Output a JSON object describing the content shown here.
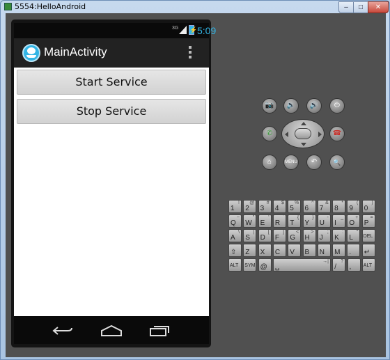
{
  "window": {
    "title": "5554:HelloAndroid",
    "min_label": "–",
    "max_label": "□",
    "close_label": "✕"
  },
  "status_bar": {
    "network": "3G",
    "time": "5:09",
    "battery_glyph": "⚡"
  },
  "action_bar": {
    "title": "MainActivity"
  },
  "buttons": {
    "start": "Start Service",
    "stop": "Stop Service"
  },
  "navbar": {
    "icons": [
      "back-icon",
      "home-icon",
      "recent-apps-icon"
    ]
  },
  "controls": {
    "camera": "📷",
    "vol_down": "🔉",
    "vol_up": "🔊",
    "power": "⏻",
    "call": "✆",
    "end_call": "☎",
    "home": "⌂",
    "menu": "MENU",
    "back": "↶",
    "search": "🔍"
  },
  "keyboard": {
    "rows": [
      [
        {
          "k": "1",
          "a": "!"
        },
        {
          "k": "2",
          "a": "@"
        },
        {
          "k": "3",
          "a": "#"
        },
        {
          "k": "4",
          "a": "$"
        },
        {
          "k": "5",
          "a": "%"
        },
        {
          "k": "6",
          "a": "^"
        },
        {
          "k": "7",
          "a": "&"
        },
        {
          "k": "8",
          "a": "*"
        },
        {
          "k": "9",
          "a": "("
        },
        {
          "k": "0",
          "a": ")"
        }
      ],
      [
        {
          "k": "Q",
          "a": "~"
        },
        {
          "k": "W",
          "a": "\""
        },
        {
          "k": "E",
          "a": "'"
        },
        {
          "k": "R",
          "a": "`"
        },
        {
          "k": "T",
          "a": "{"
        },
        {
          "k": "Y",
          "a": "}"
        },
        {
          "k": "U",
          "a": "-"
        },
        {
          "k": "I",
          "a": "_"
        },
        {
          "k": "O",
          "a": "+"
        },
        {
          "k": "P",
          "a": "="
        }
      ],
      [
        {
          "k": "A",
          "a": "\\"
        },
        {
          "k": "S",
          "a": "|"
        },
        {
          "k": "D",
          "a": "["
        },
        {
          "k": "F",
          "a": "]"
        },
        {
          "k": "G",
          "a": "<"
        },
        {
          "k": "H",
          "a": ">"
        },
        {
          "k": "J",
          "a": ";"
        },
        {
          "k": "K",
          "a": ":"
        },
        {
          "k": "L",
          "a": "\""
        },
        {
          "k": "DEL",
          "a": ""
        }
      ],
      [
        {
          "k": "⇧",
          "a": ""
        },
        {
          "k": "Z",
          "a": ""
        },
        {
          "k": "X",
          "a": ""
        },
        {
          "k": "C",
          "a": ""
        },
        {
          "k": "V",
          "a": ""
        },
        {
          "k": "B",
          "a": ""
        },
        {
          "k": "N",
          "a": ""
        },
        {
          "k": "M",
          "a": ""
        },
        {
          "k": ".",
          "a": ""
        },
        {
          "k": "↵",
          "a": ""
        }
      ],
      [
        {
          "k": "ALT",
          "a": ""
        },
        {
          "k": "SYM",
          "a": ""
        },
        {
          "k": "@",
          "a": ""
        },
        {
          "k": "␣",
          "a": "→|"
        },
        {
          "k": "/",
          "a": "?"
        },
        {
          "k": ",",
          "a": ""
        },
        {
          "k": "ALT",
          "a": ""
        }
      ]
    ]
  }
}
